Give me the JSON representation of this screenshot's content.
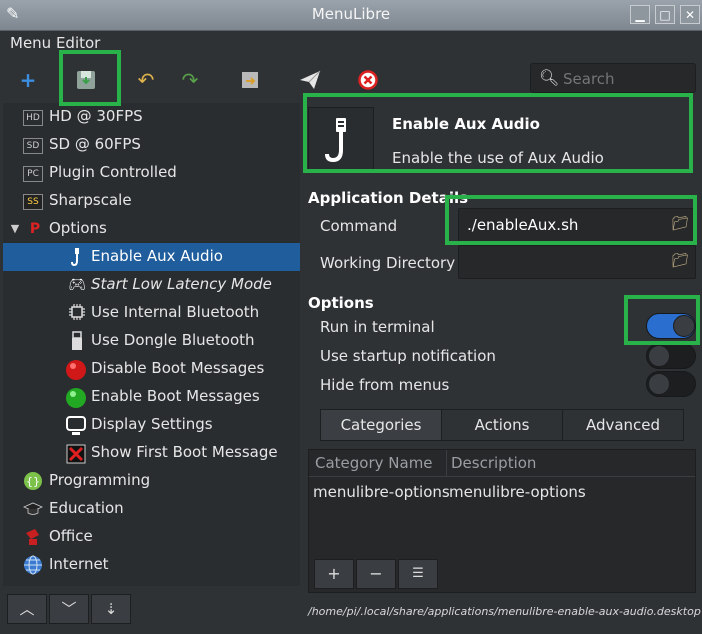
{
  "window": {
    "title": "MenuLibre"
  },
  "menubar": {
    "label": "Menu Editor"
  },
  "search": {
    "placeholder": "Search"
  },
  "sidebar": {
    "items": [
      {
        "label": "HD @ 30FPS",
        "icon": "hd-icon",
        "italic": false
      },
      {
        "label": "SD @ 60FPS",
        "icon": "sd-icon",
        "italic": false
      },
      {
        "label": "Plugin Controlled",
        "icon": "pc-icon",
        "italic": false
      },
      {
        "label": "Sharpscale",
        "icon": "ss-icon",
        "italic": false
      },
      {
        "label": "Options",
        "icon": "playstation-icon",
        "italic": false
      },
      {
        "label": "Enable Aux Audio",
        "icon": "aux-cable-icon",
        "italic": false
      },
      {
        "label": "Start Low Latency Mode",
        "icon": "gamepad-icon",
        "italic": true
      },
      {
        "label": "Use Internal Bluetooth",
        "icon": "chip-icon",
        "italic": false
      },
      {
        "label": "Use Dongle Bluetooth",
        "icon": "usb-dongle-icon",
        "italic": false
      },
      {
        "label": "Disable Boot Messages",
        "icon": "red-circle-icon",
        "italic": false
      },
      {
        "label": "Enable Boot Messages",
        "icon": "green-circle-icon",
        "italic": false
      },
      {
        "label": "Display Settings",
        "icon": "monitor-icon",
        "italic": false
      },
      {
        "label": "Show First Boot Message",
        "icon": "red-x-icon",
        "italic": false
      },
      {
        "label": "Programming",
        "icon": "braces-icon",
        "italic": false
      },
      {
        "label": "Education",
        "icon": "graduation-cap-icon",
        "italic": false
      },
      {
        "label": "Office",
        "icon": "office-icon",
        "italic": false
      },
      {
        "label": "Internet",
        "icon": "globe-icon",
        "italic": false
      }
    ]
  },
  "launcher": {
    "name": "Enable Aux Audio",
    "comment": "Enable the use of Aux Audio"
  },
  "details": {
    "section_title": "Application Details",
    "command_label": "Command",
    "command_value": "./enableAux.sh",
    "workdir_label": "Working Directory",
    "workdir_value": ""
  },
  "options": {
    "section_title": "Options",
    "run_in_terminal": {
      "label": "Run in terminal",
      "on": true
    },
    "startup_notification": {
      "label": "Use startup notification",
      "on": false
    },
    "hide_from_menus": {
      "label": "Hide from menus",
      "on": false
    }
  },
  "tabs": [
    "Categories",
    "Actions",
    "Advanced"
  ],
  "categories_table": {
    "columns": [
      "Category Name",
      "Description"
    ],
    "rows": [
      [
        "menulibre-options",
        "menulibre-options"
      ]
    ]
  },
  "filepath": "/home/pi/.local/share/applications/menulibre-enable-aux-audio.desktop",
  "colors": {
    "highlight": "#29b24a",
    "selection": "#1f5d9c",
    "toggle_on": "#2a6fd0"
  }
}
